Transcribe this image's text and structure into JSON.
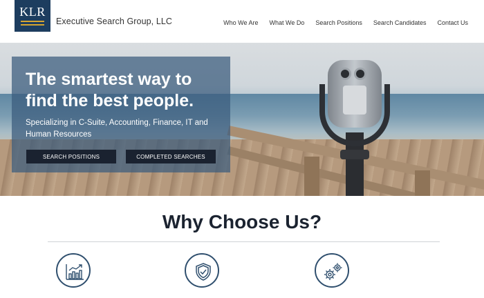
{
  "header": {
    "logo_text": "KLR",
    "company_name": "Executive Search Group, LLC",
    "nav": [
      {
        "label": "Who We Are"
      },
      {
        "label": "What We Do"
      },
      {
        "label": "Search Positions"
      },
      {
        "label": "Search Candidates"
      },
      {
        "label": "Contact Us"
      }
    ]
  },
  "hero": {
    "headline": "The smartest way to find the best people.",
    "subheadline": "Specializing in C-Suite, Accounting, Finance, IT and Human Resources",
    "buttons": {
      "search_positions": "SEARCH POSITIONS",
      "completed_searches": "COMPLETED SEARCHES"
    }
  },
  "why": {
    "title": "Why Choose Us?",
    "features": [
      {
        "icon": "growth-chart-icon"
      },
      {
        "icon": "shield-check-icon"
      },
      {
        "icon": "gears-icon"
      }
    ]
  },
  "colors": {
    "brand_navy": "#1d3d5f",
    "brand_gold": "#d6a530",
    "button_dark": "#1a2230"
  }
}
